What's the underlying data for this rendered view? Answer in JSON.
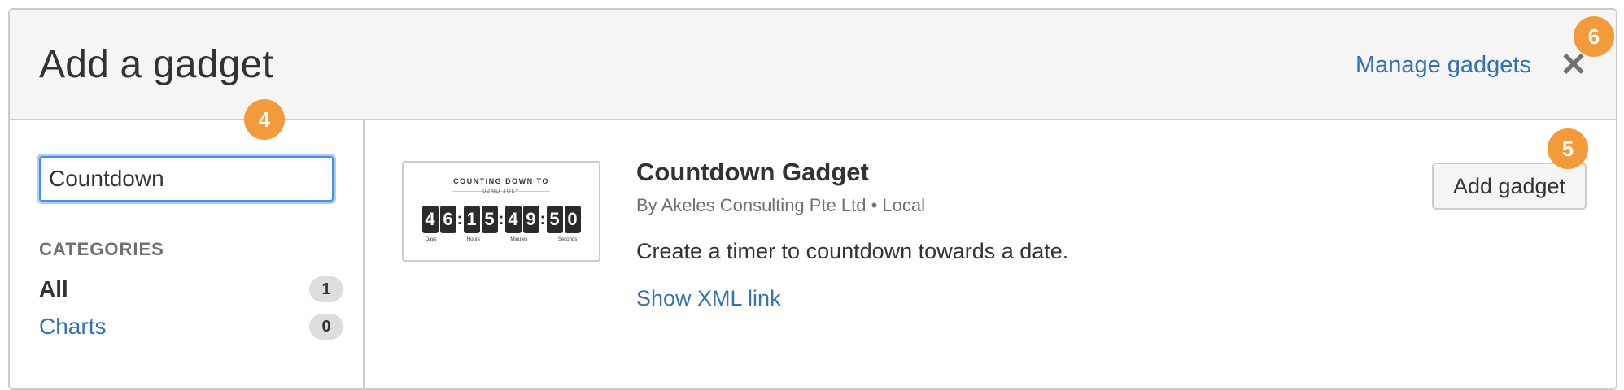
{
  "header": {
    "title": "Add a gadget",
    "manage_label": "Manage gadgets",
    "close_symbol": "✕"
  },
  "sidebar": {
    "search": {
      "value": "Countdown",
      "placeholder": ""
    },
    "categories_heading": "CATEGORIES",
    "categories": [
      {
        "label": "All",
        "count": "1",
        "active": true
      },
      {
        "label": "Charts",
        "count": "0",
        "active": false
      }
    ]
  },
  "gadget": {
    "thumbnail": {
      "title": "COUNTING DOWN TO",
      "date": "02ND JULY",
      "digits": [
        "4",
        "6",
        "1",
        "5",
        "4",
        "9",
        "5",
        "0"
      ],
      "units": [
        "Days",
        "Hours",
        "Minutes",
        "Seconds"
      ]
    },
    "title": "Countdown Gadget",
    "meta": "By Akeles Consulting Pte Ltd • Local",
    "description": "Create a timer to countdown towards a date.",
    "xml_link": "Show XML link",
    "add_label": "Add gadget"
  },
  "markers": {
    "search": "4",
    "add": "5",
    "close": "6"
  },
  "colors": {
    "link": "#3572b0",
    "marker": "#f39a3a",
    "focus_border": "#4a90e2",
    "header_bg": "#f5f5f5"
  }
}
